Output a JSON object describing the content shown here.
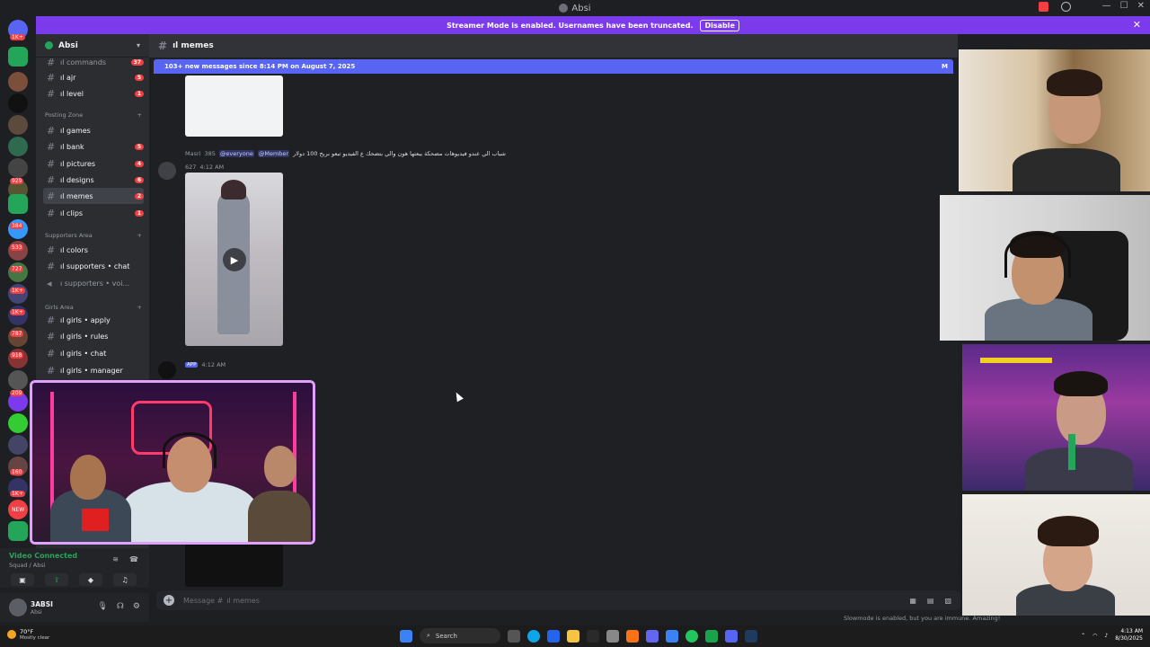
{
  "window": {
    "title": "Absi"
  },
  "banner": {
    "text": "Streamer Mode is enabled. Usernames have been truncated.",
    "disable_label": "Disable"
  },
  "server": {
    "name": "Absi"
  },
  "server_rail_badges": [
    "1K+",
    "929",
    "384",
    "533",
    "727",
    "1K+",
    "1K+",
    "787",
    "918",
    "209",
    "160",
    "1K+",
    "NEW"
  ],
  "sidebar": {
    "channels_top": [
      {
        "label": "ıl commands",
        "badge": "37"
      },
      {
        "label": "ıl ajr",
        "badge": "5"
      },
      {
        "label": "ıl level",
        "badge": "1"
      }
    ],
    "categories": [
      {
        "label": "Posting Zone"
      },
      {
        "label": "Supporters Area"
      },
      {
        "label": "Girls Area"
      }
    ],
    "posting_zone": [
      {
        "label": "ıl games",
        "badge": ""
      },
      {
        "label": "ıl bank",
        "badge": "5"
      },
      {
        "label": "ıl pictures",
        "badge": "4"
      },
      {
        "label": "ıl designs",
        "badge": "6"
      },
      {
        "label": "ıl memes",
        "badge": "2"
      },
      {
        "label": "ıl clips",
        "badge": "1"
      }
    ],
    "supporters_area": [
      {
        "label": "ıl colors"
      },
      {
        "label": "ıl supporters • chat"
      },
      {
        "label": "ı supporters • voi..."
      }
    ],
    "girls_area": [
      {
        "label": "ıl girls • apply"
      },
      {
        "label": "ıl girls • rules"
      },
      {
        "label": "ıl girls • chat"
      },
      {
        "label": "ıl girls • manager"
      }
    ]
  },
  "chat": {
    "channel_name": "ıl memes",
    "new_messages": "103+ new messages since 8:14 PM on August 7, 2025",
    "mark_label": "M",
    "message1": {
      "author": "Masri",
      "tag": "385",
      "mention1": "@everyone",
      "mention2": "@Member",
      "text": "شباب الي عندو فيديوهات مضحكة يبعتها هون والي بتضحك ع الفيديو تبعو بربح 100 دولار",
      "reply_count": "627",
      "time": "4:12 AM"
    },
    "message2": {
      "tag": "APP",
      "time": "4:12 AM"
    },
    "composer_placeholder": "Message #",
    "composer_channel": "ıl memes",
    "slowmode": "Slowmode is enabled, but you are immune. Amazing!"
  },
  "voice": {
    "status": "Video Connected",
    "location": "Squad / Absi"
  },
  "user": {
    "name": "3ABSI",
    "status": "Absi"
  },
  "taskbar": {
    "temp": "70°F",
    "condition": "Mostly clear",
    "search": "Search",
    "time": "4:13 AM",
    "date": "8/30/2025"
  },
  "colors": {
    "accent": "#5865f2",
    "banner": "#7c3aed",
    "online": "#23a55a",
    "badge": "#f23f43"
  }
}
